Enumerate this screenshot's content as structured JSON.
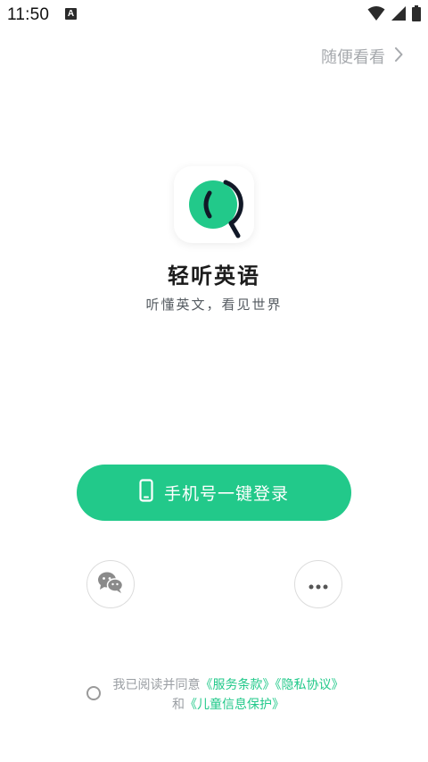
{
  "status_bar": {
    "time": "11:50",
    "notification_icon": "A"
  },
  "header": {
    "skip_label": "随便看看"
  },
  "app": {
    "name": "轻听英语",
    "slogan": "听懂英文，看见世界"
  },
  "login": {
    "primary_label": "手机号一键登录"
  },
  "agreement": {
    "prefix": "我已阅读并同意",
    "service_terms": "《服务条款》",
    "privacy": "《隐私协议》",
    "and": "和",
    "child_privacy": "《儿童信息保护》"
  },
  "colors": {
    "accent": "#22c98a",
    "muted_text": "#9a9ea3"
  }
}
